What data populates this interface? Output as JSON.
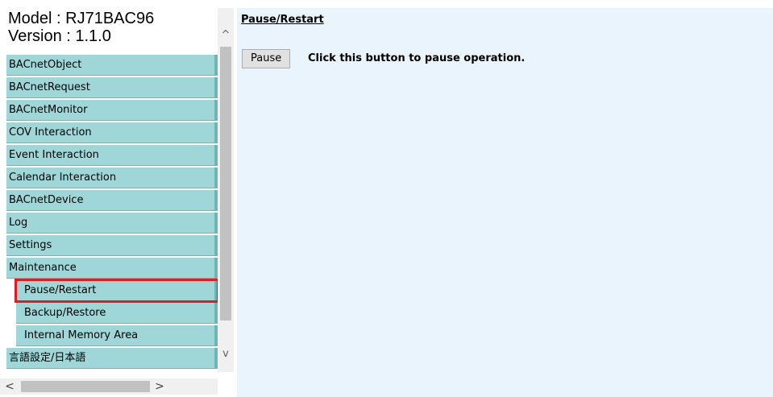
{
  "header": {
    "model": "Model : RJ71BAC96",
    "version": "Version : 1.1.0"
  },
  "nav": {
    "items": [
      {
        "label": "BACnetObject"
      },
      {
        "label": "BACnetRequest"
      },
      {
        "label": "BACnetMonitor"
      },
      {
        "label": "COV Interaction"
      },
      {
        "label": "Event Interaction"
      },
      {
        "label": "Calendar Interaction"
      },
      {
        "label": "BACnetDevice"
      },
      {
        "label": "Log"
      },
      {
        "label": "Settings"
      },
      {
        "label": "Maintenance"
      }
    ],
    "sub_items": [
      {
        "label": "Pause/Restart",
        "selected": true
      },
      {
        "label": "Backup/Restore"
      },
      {
        "label": "Internal Memory Area"
      }
    ],
    "language": {
      "label": "言語設定/日本語"
    }
  },
  "scrollbars": {
    "up": "^",
    "down": "v",
    "left": "<",
    "right": ">"
  },
  "main": {
    "title": "Pause/Restart",
    "pause_button_label": "Pause",
    "pause_description": "Click this button to pause operation."
  },
  "colors": {
    "nav_bg": "#9fd7d8",
    "content_bg": "#eaf4fc",
    "selection": "#e8191c"
  }
}
